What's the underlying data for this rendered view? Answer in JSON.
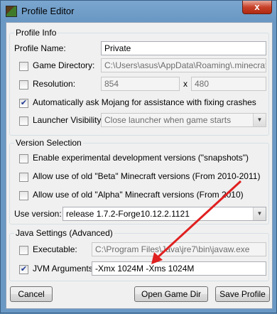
{
  "window": {
    "title": "Profile Editor",
    "close_glyph": "x"
  },
  "profile_info": {
    "group_title": "Profile Info",
    "profile_name_label": "Profile Name:",
    "profile_name_value": "Private",
    "game_directory_label": "Game Directory:",
    "game_directory_value": "C:\\Users\\asus\\AppData\\Roaming\\.minecraft",
    "resolution_label": "Resolution:",
    "resolution_width": "854",
    "resolution_x": "x",
    "resolution_height": "480",
    "auto_ask_label": "Automatically ask Mojang for assistance with fixing crashes",
    "launcher_visibility_label": "Launcher Visibility:",
    "launcher_visibility_value": "Close launcher when game starts"
  },
  "version_selection": {
    "group_title": "Version Selection",
    "snapshots_label": "Enable experimental development versions (\"snapshots\")",
    "beta_label": "Allow use of old \"Beta\" Minecraft versions (From 2010-2011)",
    "alpha_label": "Allow use of old \"Alpha\" Minecraft versions (From 2010)",
    "use_version_label": "Use version:",
    "use_version_value": "release 1.7.2-Forge10.12.2.1121"
  },
  "java_settings": {
    "group_title": "Java Settings (Advanced)",
    "executable_label": "Executable:",
    "executable_value": "C:\\Program Files\\Java\\jre7\\bin\\javaw.exe",
    "jvm_arguments_label": "JVM Arguments:",
    "jvm_arguments_value": "-Xmx 1024M -Xms 1024M"
  },
  "buttons": {
    "cancel": "Cancel",
    "open_game_dir": "Open Game Dir",
    "save_profile": "Save Profile"
  },
  "checkboxes": {
    "game_directory": false,
    "resolution": false,
    "auto_ask": true,
    "launcher_visibility": false,
    "snapshots": false,
    "beta": false,
    "alpha": false,
    "executable": false,
    "jvm_arguments": true
  },
  "colors": {
    "annotation_arrow": "#e02020",
    "titlebar": "#6a98c4"
  },
  "icons": {
    "app": "minecraft-grass-block-icon",
    "dropdown": "chevron-down-icon",
    "check": "checkmark-icon"
  }
}
